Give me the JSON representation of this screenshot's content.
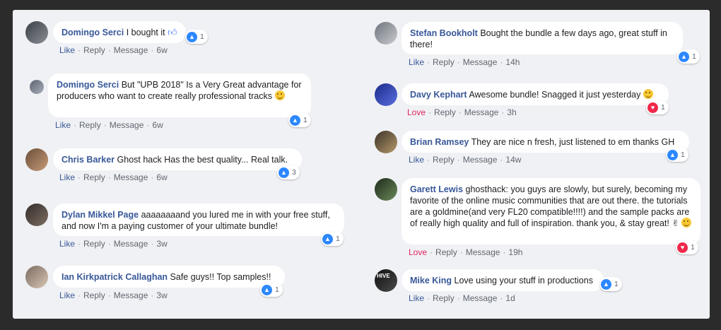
{
  "left": [
    {
      "author": "Domingo Serci",
      "text": "I bought it",
      "emoji": "thumb",
      "react_type": "like",
      "count": "1",
      "a1": "Like",
      "a2": "Reply",
      "a3": "Message",
      "time": "6w"
    },
    {
      "author": "Domingo Serci",
      "text": "But \"UPB 2018\" Is a Very Great advantage for producers who want to create really professional tracks",
      "emoji": "wink",
      "react_type": "like",
      "count": "1",
      "a1": "Like",
      "a2": "Reply",
      "a3": "Message",
      "time": "6w"
    },
    {
      "author": "Chris Barker",
      "text": "Ghost hack Has the best quality... Real talk.",
      "emoji": "",
      "react_type": "like",
      "count": "3",
      "a1": "Like",
      "a2": "Reply",
      "a3": "Message",
      "time": "6w"
    },
    {
      "author": "Dylan Mikkel Page",
      "text": "aaaaaaaand you lured me in with your free stuff, and now I'm a paying customer of your ultimate bundle!",
      "emoji": "",
      "react_type": "like",
      "count": "1",
      "a1": "Like",
      "a2": "Reply",
      "a3": "Message",
      "time": "3w"
    },
    {
      "author": "Ian Kirkpatrick Callaghan",
      "text": "Safe guys!! Top samples!!",
      "emoji": "",
      "react_type": "like",
      "count": "1",
      "a1": "Like",
      "a2": "Reply",
      "a3": "Message",
      "time": "3w"
    }
  ],
  "right": [
    {
      "author": "Stefan Bookholt",
      "text": "Bought the bundle a few days ago, great stuff in there!",
      "emoji": "",
      "react_type": "like",
      "count": "1",
      "a1": "Like",
      "a2": "Reply",
      "a3": "Message",
      "time": "14h"
    },
    {
      "author": "Davy Kephart",
      "text": "Awesome bundle! Snagged it just yesterday",
      "emoji": "wink",
      "react_type": "love",
      "count": "1",
      "a1": "Love",
      "a2": "Reply",
      "a3": "Message",
      "time": "3h"
    },
    {
      "author": "Brian Ramsey",
      "text": "They are nice n fresh, just listened to em thanks GH",
      "emoji": "",
      "react_type": "like",
      "count": "1",
      "a1": "Like",
      "a2": "Reply",
      "a3": "Message",
      "time": "14w"
    },
    {
      "author": "Garett Lewis",
      "text": "ghosthack: you guys are slowly, but surely, becoming my favorite of the online music communities that are out there. the tutorials are a goldmine(and very FL20 compatible!!!!) and the sample packs are of really high quality and full of inspiration. thank you, & stay great!",
      "emoji": "victory-smile",
      "react_type": "love",
      "count": "1",
      "a1": "Love",
      "a2": "Reply",
      "a3": "Message",
      "time": "19h"
    },
    {
      "author": "Mike King",
      "text": "Love using your stuff in productions",
      "emoji": "",
      "react_type": "like",
      "count": "1",
      "a1": "Like",
      "a2": "Reply",
      "a3": "Message",
      "time": "1d"
    }
  ],
  "colors": {
    "author": "#385898",
    "like": "#2d88ff",
    "love": "#e0245e",
    "bubble": "#ffffff",
    "panel": "#f0f1f4"
  },
  "icons": {
    "like": "thumbs-up-icon",
    "love": "heart-icon",
    "wink": "wink-emoji-icon",
    "victory": "victory-hand-icon"
  }
}
